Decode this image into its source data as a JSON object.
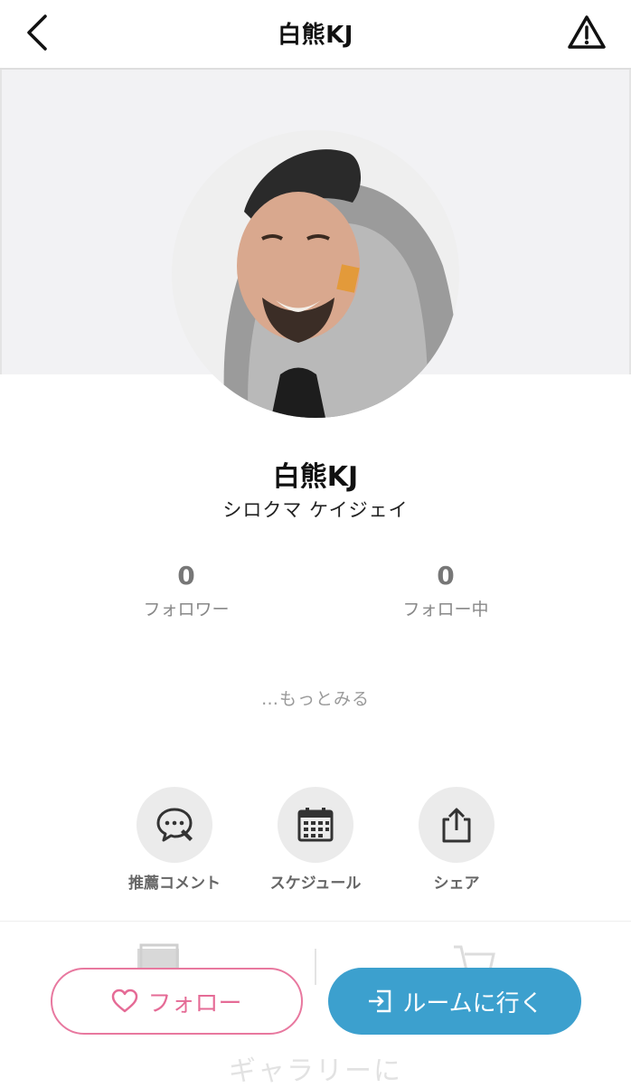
{
  "header": {
    "title": "白熊KJ",
    "back_icon": "chevron-left-icon",
    "warn_icon": "warning-triangle-icon"
  },
  "profile": {
    "name": "白熊KJ",
    "kana": "シロクマ ケイジェイ"
  },
  "stats": {
    "followers_count": "0",
    "followers_label": "フォロワー",
    "following_count": "0",
    "following_label": "フォロー中"
  },
  "more_label": "…もっとみる",
  "actions": {
    "comment_label": "推薦コメント",
    "schedule_label": "スケジュール",
    "share_label": "シェア"
  },
  "tabs": {
    "faded_text": "ギャラリーに"
  },
  "buttons": {
    "follow_label": "フォロー",
    "room_label": "ルームに行く"
  },
  "colors": {
    "accent_pink": "#e56b96",
    "accent_blue": "#3ca0ce"
  }
}
